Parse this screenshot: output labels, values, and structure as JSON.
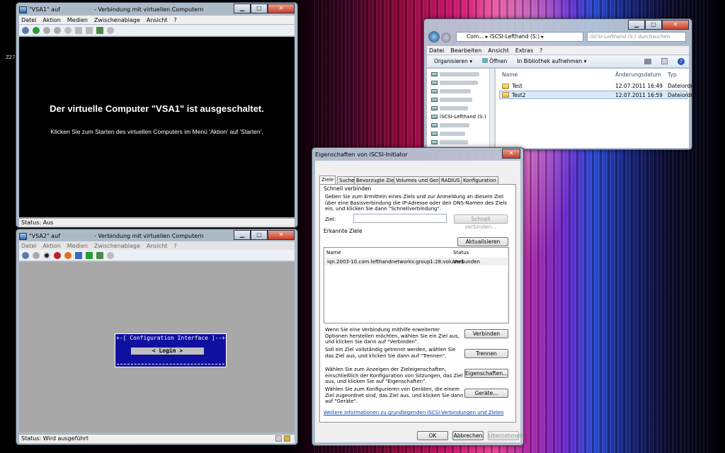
{
  "desktop": {
    "side_label": "Z27"
  },
  "vsa1": {
    "title_a": "\"VSA1\" auf",
    "title_b": "- Verbindung mit virtuellen Computern",
    "menu": [
      "Datei",
      "Aktion",
      "Medien",
      "Zwischenablage",
      "Ansicht",
      "?"
    ],
    "message": "Der virtuelle Computer \"VSA1\" ist ausgeschaltet.",
    "hint": "Klicken Sie zum Starten des virtuellen Computers im Menü 'Aktion' auf 'Starten'.",
    "status": "Status: Aus"
  },
  "vsa2": {
    "title_a": "\"VSA2\" auf",
    "title_b": "- Verbindung mit virtuellen Computern",
    "menu": [
      "Datei",
      "Aktion",
      "Medien",
      "Zwischenablage",
      "Ansicht",
      "?"
    ],
    "console_title": "+-[ Configuration Interface ]--+",
    "login": "< Login >",
    "status": "Status: Wird ausgeführt"
  },
  "explorer": {
    "path_1": "Com...",
    "path_2": "iSCSI-Lefthand (S:)",
    "search_placeholder": "iSCSI-Lefthand (S:) durchsuchen",
    "menu": [
      "Datei",
      "Bearbeiten",
      "Ansicht",
      "Extras",
      "?"
    ],
    "cmd_organize": "Organisieren ▾",
    "cmd_open": "Öffnen",
    "cmd_library": "In Bibliothek aufnehmen ▾",
    "nav_drive": "iSCSI-Lefthand (S:)",
    "col_name": "Name",
    "col_date": "Änderungsdatum",
    "col_type": "Typ",
    "files": [
      {
        "name": "Test",
        "date": "12.07.2011 16:49",
        "type": "Dateiordn"
      },
      {
        "name": "Test2",
        "date": "12.07.2011 16:59",
        "type": "Dateiordn"
      }
    ]
  },
  "iscsi": {
    "title": "Eigenschaften von iSCSI-Initiator",
    "tabs": [
      "Ziele",
      "Suche",
      "Bevorzugte Ziele",
      "Volumes und Geräte",
      "RADIUS",
      "Konfiguration"
    ],
    "quick_head": "Schnell verbinden",
    "quick_text": "Geben Sie zum Ermitteln eines Ziels und zur Anmeldung an diesem Ziel über eine Basisverbindung die IP-Adresse oder den DNS-Namen des Ziels ein, und klicken Sie dann \"Schnellverbindung\".",
    "target_label": "Ziel:",
    "target_value": "",
    "quick_btn": "Schnell verbinden...",
    "found_head": "Erkannte Ziele",
    "refresh_btn": "Aktualisieren",
    "col_name": "Name",
    "col_status": "Status",
    "rows": [
      {
        "name": "iqn.2003-10.com.lefthandnetworks:group1:28:volume1",
        "status": "Verbunden"
      }
    ],
    "txt_connect": "Wenn Sie eine Verbindung mithilfe erweiterter Optionen herstellen möchten, wählen Sie ein Ziel aus, und klicken Sie dann auf \"Verbinden\".",
    "btn_connect": "Verbinden",
    "txt_disconnect": "Soll ein Ziel vollständig getrennt werden, wählen Sie das Ziel aus, und klicken Sie dann auf \"Trennen\".",
    "btn_disconnect": "Trennen",
    "txt_props": "Wählen Sie zum Anzeigen der Zieleigenschaften, einschließlich der Konfiguration von Sitzungen, das Ziel aus, und klicken Sie auf \"Eigenschaften\".",
    "btn_props": "Eigenschaften...",
    "txt_devices": "Wählen Sie zum Konfigurieren von Geräten, die einem Ziel zugeordnet sind, das Ziel aus, und klicken Sie dann auf \"Geräte\".",
    "btn_devices": "Geräte...",
    "link": "Weitere Informationen zu grundlegenden iSCSI-Verbindungen und Zielen",
    "btn_ok": "OK",
    "btn_cancel": "Abbrechen",
    "btn_apply": "Übernehmen"
  }
}
